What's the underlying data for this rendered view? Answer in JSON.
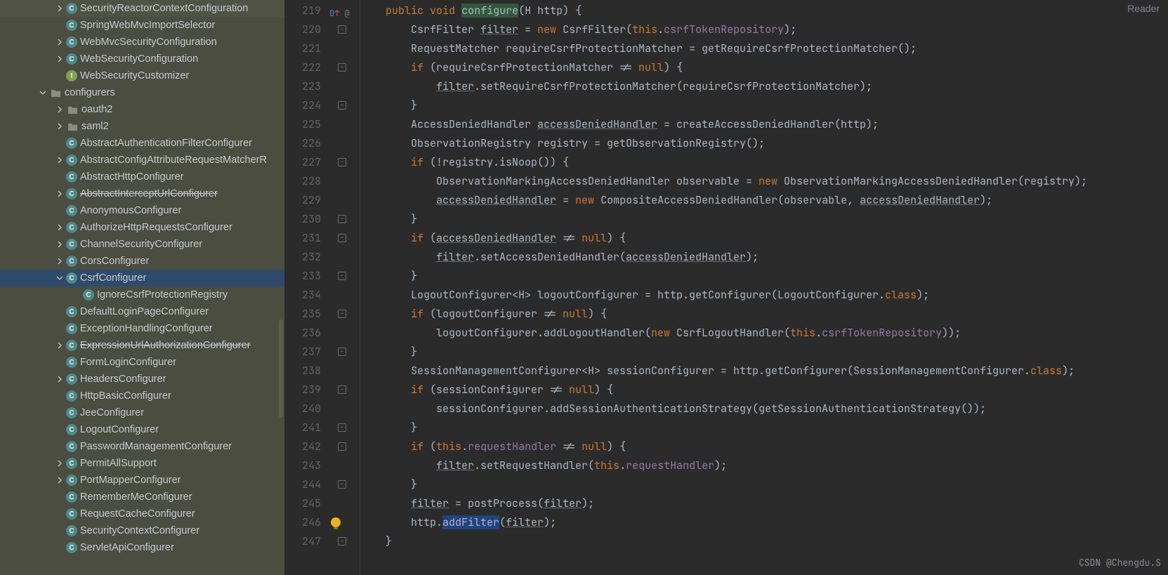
{
  "ui": {
    "reader_label": "Reader",
    "watermark": "CSDN @Chengdu.S"
  },
  "tree": [
    {
      "depth": 3,
      "chev": "r",
      "icon": "class",
      "label": "SecurityReactorContextConfiguration",
      "strike": false,
      "sel": false,
      "truncated": true
    },
    {
      "depth": 3,
      "chev": "",
      "icon": "class",
      "label": "SpringWebMvcImportSelector",
      "strike": false,
      "sel": false
    },
    {
      "depth": 3,
      "chev": "r",
      "icon": "class",
      "label": "WebMvcSecurityConfiguration",
      "strike": false,
      "sel": false
    },
    {
      "depth": 3,
      "chev": "r",
      "icon": "class",
      "label": "WebSecurityConfiguration",
      "strike": false,
      "sel": false
    },
    {
      "depth": 3,
      "chev": "",
      "icon": "interface",
      "label": "WebSecurityCustomizer",
      "strike": false,
      "sel": false
    },
    {
      "depth": 1,
      "chev": "d",
      "icon": "folder",
      "label": "configurers",
      "strike": false,
      "sel": false
    },
    {
      "depth": 2,
      "chev": "r",
      "icon": "folder",
      "label": "oauth2",
      "strike": false,
      "sel": false
    },
    {
      "depth": 2,
      "chev": "r",
      "icon": "folder",
      "label": "saml2",
      "strike": false,
      "sel": false
    },
    {
      "depth": 3,
      "chev": "",
      "icon": "class",
      "label": "AbstractAuthenticationFilterConfigurer",
      "strike": false,
      "sel": false
    },
    {
      "depth": 2,
      "chev": "r",
      "icon": "class",
      "label": "AbstractConfigAttributeRequestMatcherR",
      "strike": false,
      "sel": false
    },
    {
      "depth": 3,
      "chev": "",
      "icon": "class",
      "label": "AbstractHttpConfigurer",
      "strike": false,
      "sel": false
    },
    {
      "depth": 2,
      "chev": "r",
      "icon": "class",
      "label": "AbstractInterceptUrlConfigurer",
      "strike": true,
      "sel": false
    },
    {
      "depth": 3,
      "chev": "",
      "icon": "class",
      "label": "AnonymousConfigurer",
      "strike": false,
      "sel": false
    },
    {
      "depth": 2,
      "chev": "r",
      "icon": "class",
      "label": "AuthorizeHttpRequestsConfigurer",
      "strike": false,
      "sel": false
    },
    {
      "depth": 2,
      "chev": "r",
      "icon": "class",
      "label": "ChannelSecurityConfigurer",
      "strike": false,
      "sel": false
    },
    {
      "depth": 2,
      "chev": "r",
      "icon": "class",
      "label": "CorsConfigurer",
      "strike": false,
      "sel": false
    },
    {
      "depth": 2,
      "chev": "d",
      "icon": "class",
      "label": "CsrfConfigurer",
      "strike": false,
      "sel": true
    },
    {
      "depth": 4,
      "chev": "",
      "icon": "class",
      "label": "IgnoreCsrfProtectionRegistry",
      "strike": false,
      "sel": false
    },
    {
      "depth": 3,
      "chev": "",
      "icon": "class",
      "label": "DefaultLoginPageConfigurer",
      "strike": false,
      "sel": false
    },
    {
      "depth": 3,
      "chev": "",
      "icon": "class",
      "label": "ExceptionHandlingConfigurer",
      "strike": false,
      "sel": false
    },
    {
      "depth": 2,
      "chev": "r",
      "icon": "class",
      "label": "ExpressionUrlAuthorizationConfigurer",
      "strike": true,
      "sel": false
    },
    {
      "depth": 3,
      "chev": "",
      "icon": "class",
      "label": "FormLoginConfigurer",
      "strike": false,
      "sel": false
    },
    {
      "depth": 2,
      "chev": "r",
      "icon": "class",
      "label": "HeadersConfigurer",
      "strike": false,
      "sel": false
    },
    {
      "depth": 3,
      "chev": "",
      "icon": "class",
      "label": "HttpBasicConfigurer",
      "strike": false,
      "sel": false
    },
    {
      "depth": 3,
      "chev": "",
      "icon": "class",
      "label": "JeeConfigurer",
      "strike": false,
      "sel": false
    },
    {
      "depth": 3,
      "chev": "",
      "icon": "class",
      "label": "LogoutConfigurer",
      "strike": false,
      "sel": false
    },
    {
      "depth": 3,
      "chev": "",
      "icon": "class",
      "label": "PasswordManagementConfigurer",
      "strike": false,
      "sel": false
    },
    {
      "depth": 2,
      "chev": "r",
      "icon": "class",
      "label": "PermitAllSupport",
      "strike": false,
      "sel": false
    },
    {
      "depth": 2,
      "chev": "r",
      "icon": "class",
      "label": "PortMapperConfigurer",
      "strike": false,
      "sel": false
    },
    {
      "depth": 3,
      "chev": "",
      "icon": "class",
      "label": "RememberMeConfigurer",
      "strike": false,
      "sel": false
    },
    {
      "depth": 3,
      "chev": "",
      "icon": "class",
      "label": "RequestCacheConfigurer",
      "strike": false,
      "sel": false
    },
    {
      "depth": 3,
      "chev": "",
      "icon": "class",
      "label": "SecurityContextConfigurer",
      "strike": false,
      "sel": false
    },
    {
      "depth": 3,
      "chev": "",
      "icon": "class",
      "label": "ServletApiConfigurer",
      "strike": false,
      "sel": false,
      "truncated": true
    }
  ],
  "code": {
    "lines": [
      {
        "n": 219,
        "annot": "override",
        "html": "    <span class='kw'>public</span> <span class='kw'>void</span> <span class='hl'>configure</span>(<span class='type'>H</span> http) {"
      },
      {
        "n": 220,
        "fold": "s",
        "html": "        CsrfFilter <span class='und'>filter</span> = <span class='kw'>new</span> CsrfFilter(<span class='kw'>this</span>.<span class='fld'>csrfTokenRepository</span>);"
      },
      {
        "n": 221,
        "html": "        RequestMatcher requireCsrfProtectionMatcher = getRequireCsrfProtectionMatcher();"
      },
      {
        "n": 222,
        "fold": "s",
        "html": "        <span class='kw'>if</span> (requireCsrfProtectionMatcher != <span class='kw'>null</span>) {"
      },
      {
        "n": 223,
        "html": "            <span class='und'>filter</span>.setRequireCsrfProtectionMatcher(requireCsrfProtectionMatcher);"
      },
      {
        "n": 224,
        "fold": "e",
        "html": "        }"
      },
      {
        "n": 225,
        "html": "        AccessDeniedHandler <span class='und'>accessDeniedHandler</span> = createAccessDeniedHandler(http);"
      },
      {
        "n": 226,
        "html": "        ObservationRegistry registry = getObservationRegistry();"
      },
      {
        "n": 227,
        "fold": "s",
        "html": "        <span class='kw'>if</span> (!registry.isNoop()) {"
      },
      {
        "n": 228,
        "html": "            ObservationMarkingAccessDeniedHandler observable = <span class='kw'>new</span> ObservationMarkingAccessDeniedHandler(registry);"
      },
      {
        "n": 229,
        "html": "            <span class='und'>accessDeniedHandler</span> = <span class='kw'>new</span> CompositeAccessDeniedHandler(observable, <span class='und'>accessDeniedHandler</span>);"
      },
      {
        "n": 230,
        "fold": "e",
        "html": "        }"
      },
      {
        "n": 231,
        "fold": "s",
        "html": "        <span class='kw'>if</span> (<span class='und'>accessDeniedHandler</span> != <span class='kw'>null</span>) {"
      },
      {
        "n": 232,
        "html": "            <span class='und'>filter</span>.setAccessDeniedHandler(<span class='und'>accessDeniedHandler</span>);"
      },
      {
        "n": 233,
        "fold": "e",
        "html": "        }"
      },
      {
        "n": 234,
        "html": "        LogoutConfigurer&lt;<span class='type'>H</span>&gt; logoutConfigurer = http.getConfigurer(LogoutConfigurer.<span class='kw'>class</span>);"
      },
      {
        "n": 235,
        "fold": "s",
        "html": "        <span class='kw'>if</span> (logoutConfigurer != <span class='kw'>null</span>) {"
      },
      {
        "n": 236,
        "html": "            logoutConfigurer.addLogoutHandler(<span class='kw'>new</span> CsrfLogoutHandler(<span class='kw'>this</span>.<span class='fld'>csrfTokenRepository</span>));"
      },
      {
        "n": 237,
        "fold": "e",
        "html": "        }"
      },
      {
        "n": 238,
        "html": "        SessionManagementConfigurer&lt;<span class='type'>H</span>&gt; sessionConfigurer = http.getConfigurer(SessionManagementConfigurer.<span class='kw'>class</span>);"
      },
      {
        "n": 239,
        "fold": "s",
        "html": "        <span class='kw'>if</span> (sessionConfigurer != <span class='kw'>null</span>) {"
      },
      {
        "n": 240,
        "html": "            sessionConfigurer.addSessionAuthenticationStrategy(getSessionAuthenticationStrategy());"
      },
      {
        "n": 241,
        "fold": "e",
        "html": "        }"
      },
      {
        "n": 242,
        "fold": "s",
        "html": "        <span class='kw'>if</span> (<span class='kw'>this</span>.<span class='fld'>requestHandler</span> != <span class='kw'>null</span>) {"
      },
      {
        "n": 243,
        "html": "            <span class='und'>filter</span>.setRequestHandler(<span class='kw'>this</span>.<span class='fld'>requestHandler</span>);"
      },
      {
        "n": 244,
        "fold": "e",
        "html": "        }"
      },
      {
        "n": 245,
        "html": "        <span class='und'>filter</span> = postProcess(<span class='und'>filter</span>);"
      },
      {
        "n": 246,
        "bulb": true,
        "html": "        http.<span class='hl2'>addFilter</span>(<span class='und'>filter</span>);"
      },
      {
        "n": 247,
        "fold": "e",
        "html": "    }"
      }
    ]
  }
}
